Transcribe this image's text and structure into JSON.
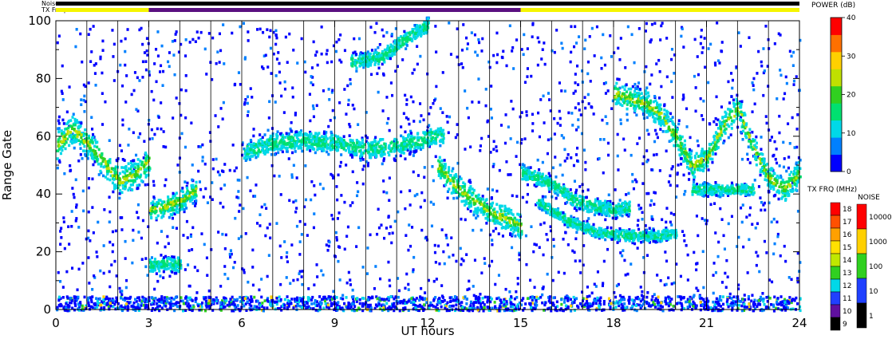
{
  "chart_data": {
    "type": "heatmap",
    "xlabel": "UT hours",
    "ylabel": "Range Gate",
    "xlim": [
      0,
      24
    ],
    "ylim": [
      0,
      100
    ],
    "x_ticks": [
      "0",
      "3",
      "6",
      "9",
      "12",
      "15",
      "18",
      "21",
      "24"
    ],
    "x_tick_values": [
      0,
      3,
      6,
      9,
      12,
      15,
      18,
      21,
      24
    ],
    "y_ticks": [
      "0",
      "20",
      "40",
      "60",
      "80",
      "100"
    ],
    "y_tick_values": [
      0,
      20,
      40,
      60,
      80,
      100
    ],
    "scan_boundaries": [
      1,
      2,
      3,
      4,
      5,
      6,
      7,
      8,
      9,
      10,
      11,
      12,
      13,
      14,
      15,
      16,
      17,
      18,
      19,
      20,
      21,
      22,
      23
    ],
    "top_bars": {
      "noise_label": "Noise",
      "txfreq_label": "TX Freq",
      "txfreq_segments": [
        {
          "start": 0,
          "end": 3,
          "color": "#f5f500"
        },
        {
          "start": 3,
          "end": 15,
          "color": "#5a1080"
        },
        {
          "start": 15,
          "end": 24,
          "color": "#f5f500"
        }
      ],
      "noise_color": "#000000"
    },
    "power_colorbar": {
      "title": "POWER (dB)",
      "ticks": [
        "40",
        "30",
        "20",
        "10",
        "0"
      ],
      "tick_values": [
        40,
        30,
        20,
        10,
        0
      ],
      "range": [
        0,
        40
      ],
      "colors": [
        "#0000ff",
        "#0080ff",
        "#00d8e8",
        "#00e070",
        "#30d020",
        "#c0e000",
        "#ffd000",
        "#ff7000",
        "#ff0000"
      ]
    },
    "txfreq_colorbar": {
      "title": "TX FRQ (MHz)",
      "labels": [
        "18",
        "17",
        "16",
        "15",
        "14",
        "13",
        "12",
        "11",
        "10",
        "9"
      ],
      "colors": [
        "#ff0000",
        "#ff5000",
        "#ffa000",
        "#ffe000",
        "#c0e800",
        "#30d020",
        "#00d8e8",
        "#2040ff",
        "#6010a0",
        "#000000"
      ]
    },
    "noise_colorbar": {
      "title": "NOISE",
      "labels": [
        "10000",
        "1000",
        "100",
        "10",
        "1"
      ],
      "colors": [
        "#ff0000",
        "#ffd000",
        "#30d020",
        "#2040ff",
        "#000000"
      ]
    },
    "series": [
      {
        "points": [
          [
            0.0,
            57
          ],
          [
            0.5,
            63
          ],
          [
            1.0,
            58
          ],
          [
            1.5,
            52
          ],
          [
            2.0,
            45
          ],
          [
            2.5,
            47
          ],
          [
            3.0,
            52
          ]
        ],
        "width": 8
      },
      {
        "points": [
          [
            3.0,
            35
          ],
          [
            3.5,
            36
          ],
          [
            4.0,
            38
          ],
          [
            4.5,
            42
          ]
        ],
        "width": 6
      },
      {
        "points": [
          [
            3.0,
            16
          ],
          [
            3.5,
            16
          ],
          [
            4.0,
            16
          ]
        ],
        "width": 4
      },
      {
        "points": [
          [
            6.0,
            55
          ],
          [
            7.0,
            58
          ],
          [
            8.0,
            59
          ],
          [
            9.0,
            58
          ],
          [
            10.0,
            56
          ],
          [
            11.0,
            57
          ],
          [
            12.0,
            60
          ],
          [
            12.5,
            61
          ]
        ],
        "width": 5
      },
      {
        "points": [
          [
            9.5,
            86
          ],
          [
            10.5,
            88
          ],
          [
            11.0,
            92
          ],
          [
            11.5,
            96
          ],
          [
            12.0,
            99
          ]
        ],
        "width": 4
      },
      {
        "points": [
          [
            12.3,
            50
          ],
          [
            13.0,
            42
          ],
          [
            13.5,
            38
          ],
          [
            14.0,
            34
          ],
          [
            14.5,
            32
          ],
          [
            15.0,
            29
          ]
        ],
        "width": 7
      },
      {
        "points": [
          [
            15.0,
            48
          ],
          [
            16.0,
            44
          ],
          [
            16.5,
            40
          ],
          [
            17.0,
            37
          ],
          [
            18.0,
            35
          ],
          [
            18.5,
            36
          ]
        ],
        "width": 4
      },
      {
        "points": [
          [
            15.5,
            38
          ],
          [
            16.5,
            31
          ],
          [
            17.5,
            27
          ],
          [
            18.5,
            26
          ],
          [
            19.5,
            26
          ],
          [
            20.0,
            27
          ]
        ],
        "width": 3
      },
      {
        "points": [
          [
            18.0,
            75
          ],
          [
            19.0,
            72
          ],
          [
            19.5,
            68
          ],
          [
            20.0,
            60
          ],
          [
            20.5,
            50
          ],
          [
            21.0,
            53
          ],
          [
            21.5,
            64
          ],
          [
            22.0,
            70
          ],
          [
            22.5,
            56
          ],
          [
            23.0,
            46
          ],
          [
            23.5,
            42
          ],
          [
            24.0,
            48
          ]
        ],
        "width": 7
      },
      {
        "points": [
          [
            20.5,
            42
          ],
          [
            21.5,
            42
          ],
          [
            22.5,
            42
          ]
        ],
        "width": 3
      }
    ]
  }
}
